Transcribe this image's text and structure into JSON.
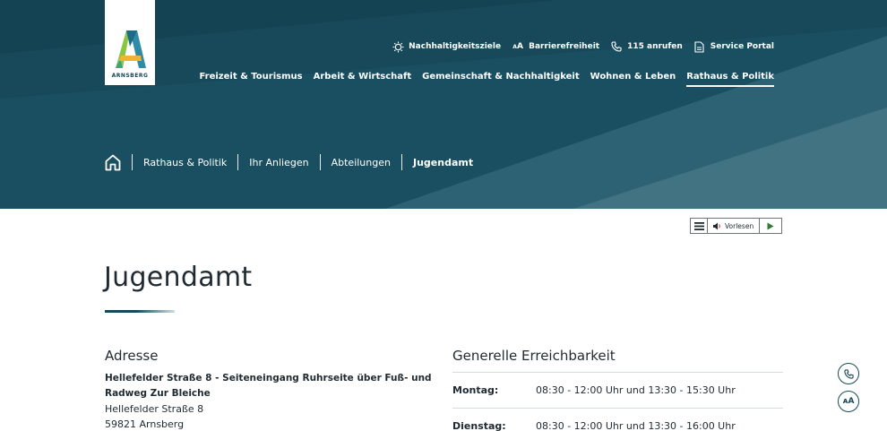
{
  "brand": {
    "name": "ARNSBERG",
    "primary": "#17495a",
    "accent": "#ffffff"
  },
  "service_nav": [
    {
      "icon": "sun-icon",
      "label": "Nachhaltigkeitsziele"
    },
    {
      "icon": "text-size-icon",
      "label": "Barrierefreiheit"
    },
    {
      "icon": "phone-icon",
      "label": "115 anrufen"
    },
    {
      "icon": "document-icon",
      "label": "Service Portal"
    }
  ],
  "main_nav": [
    {
      "label": "Freizeit & Tourismus"
    },
    {
      "label": "Arbeit & Wirtschaft"
    },
    {
      "label": "Gemeinschaft & Nachhaltigkeit"
    },
    {
      "label": "Wohnen & Leben"
    },
    {
      "label": "Rathaus & Politik",
      "active": true
    }
  ],
  "breadcrumb": [
    "Rathaus & Politik",
    "Ihr Anliegen",
    "Abteilungen",
    "Jugendamt"
  ],
  "readspeaker": {
    "label": "Vorlesen"
  },
  "page": {
    "title": "Jugendamt"
  },
  "address": {
    "heading": "Adresse",
    "street_bold": "Hellefelder Straße 8 - Seiteneingang Ruhrseite über Fuß- und Radweg Zur Bleiche",
    "street": "Hellefelder Straße 8",
    "city": "59821 Arnsberg"
  },
  "availability": {
    "heading": "Generelle Erreichbarkeit",
    "rows": [
      {
        "day": "Montag:",
        "hours": "08:30 - 12:00 Uhr und 13:30 - 15:30 Uhr"
      },
      {
        "day": "Dienstag:",
        "hours": "08:30 - 12:00 Uhr und 13:30 - 16:00 Uhr"
      }
    ]
  },
  "floating": {
    "phone_icon": "phone-icon",
    "text_size_label": "ᴀA"
  }
}
